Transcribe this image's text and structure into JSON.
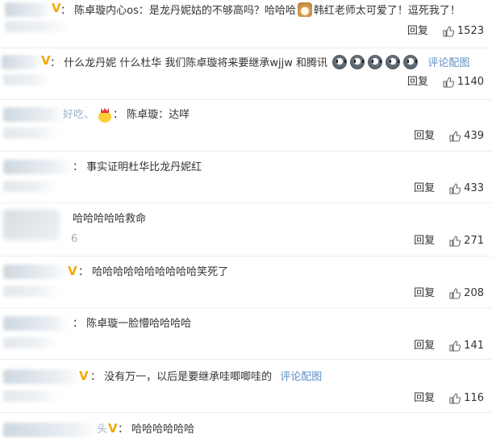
{
  "comments": [
    {
      "text": "：  陈卓璇内心os：是龙丹妮姑的不够高吗？哈哈哈",
      "text_after": "韩红老师太可爱了！逗死我了！",
      "reply": "回复",
      "likes": "1523"
    },
    {
      "text": "：  什么龙丹妮 什么杜华 我们陈卓璇将来要继承wjjw 和腾讯",
      "link": "评论配图",
      "reply": "回复",
      "likes": "1140"
    },
    {
      "partial_name": "好吃、",
      "text": "：  陈卓璇：达咩",
      "reply": "回复",
      "likes": "439"
    },
    {
      "text": "：  事实证明杜华比龙丹妮红",
      "reply": "回复",
      "likes": "433"
    },
    {
      "text": "哈哈哈哈哈救命",
      "partial_sub": "6",
      "reply": "回复",
      "likes": "271"
    },
    {
      "text": "：  哈哈哈哈哈哈哈哈哈哈笑死了",
      "reply": "回复",
      "likes": "208"
    },
    {
      "text": "：  陈卓璇一脸懵哈哈哈哈",
      "reply": "回复",
      "likes": "141"
    },
    {
      "text": "：  没有万一，以后是要继承哇唧唧哇的",
      "link": "评论配图",
      "reply": "回复",
      "likes": "116"
    },
    {
      "partial_name": "头",
      "text": "：  哈哈哈哈哈哈",
      "reply": "",
      "likes": ""
    }
  ],
  "icons": {
    "verified": "V",
    "like": "thumbs-up-icon",
    "crown": "crown-icon",
    "emoji": "face-emoji-icon",
    "dog": "dog-emoji-icon"
  },
  "colors": {
    "link": "#5d8fc7",
    "verified": "#f2a70a",
    "text": "#333333",
    "divider": "#eeeeee"
  }
}
